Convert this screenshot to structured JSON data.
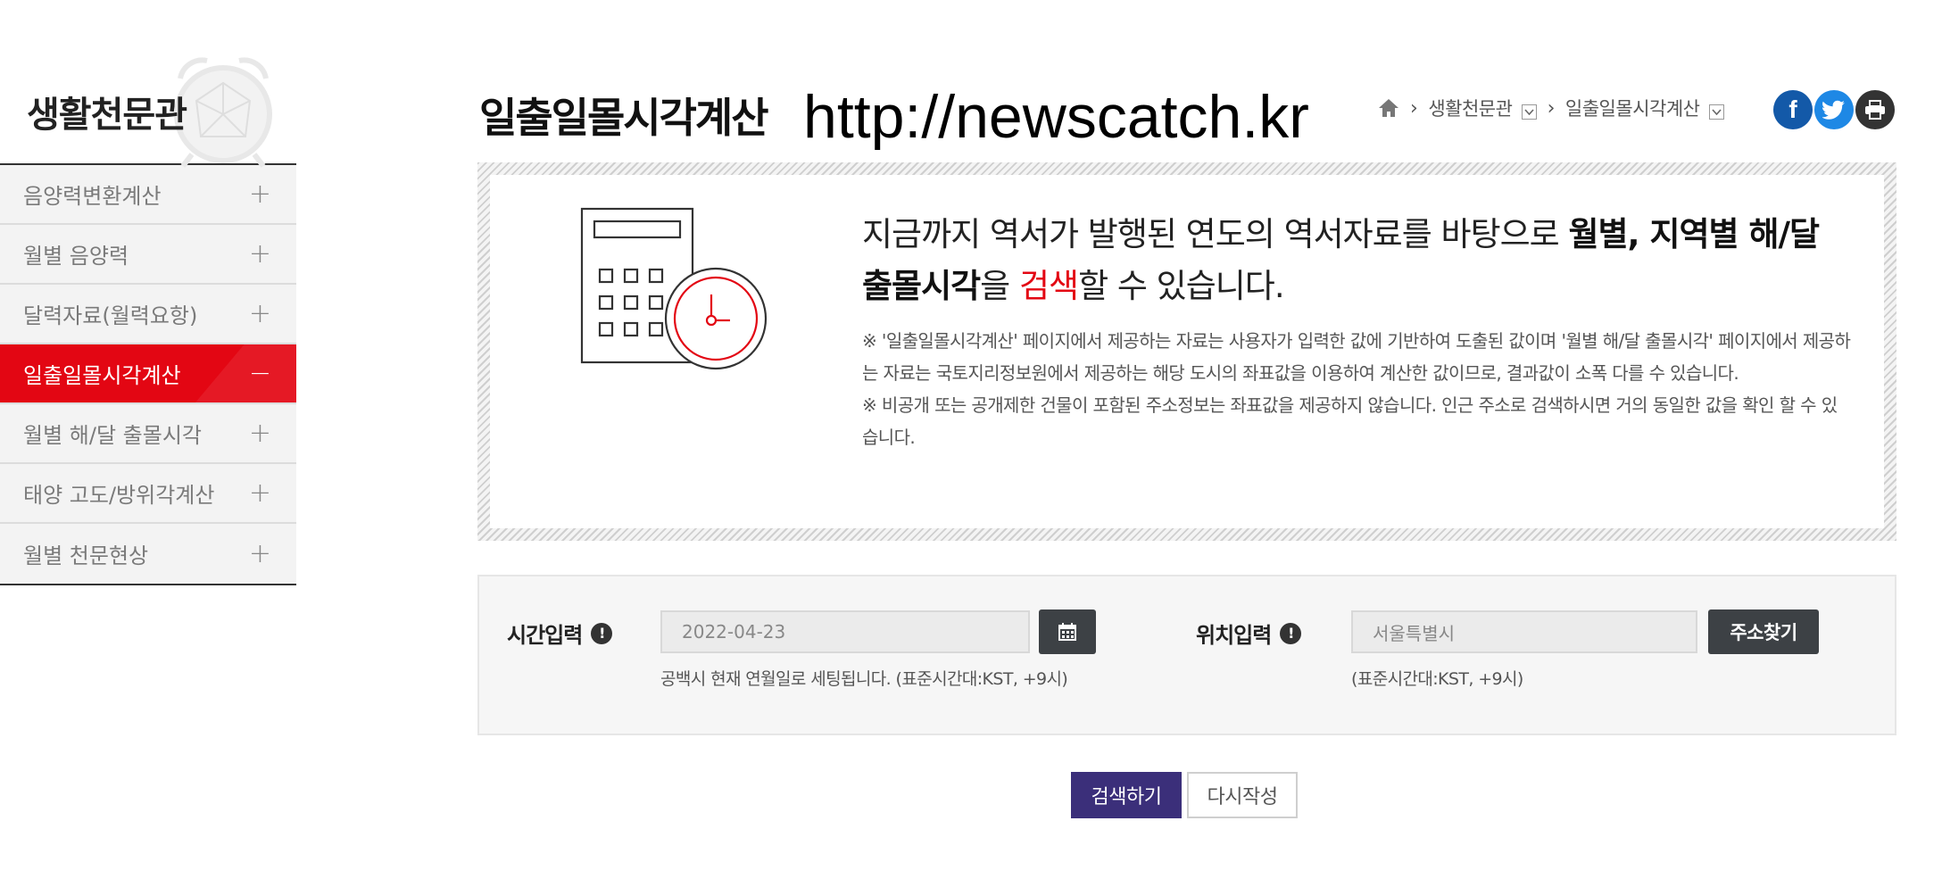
{
  "sidebar": {
    "title": "생활천문관",
    "items": [
      {
        "label": "음양력변환계산",
        "toggle": "+"
      },
      {
        "label": "월별 음양력",
        "toggle": "+"
      },
      {
        "label": "달력자료(월력요항)",
        "toggle": "+"
      },
      {
        "label": "일출일몰시각계산",
        "toggle": "−",
        "active": true
      },
      {
        "label": "월별 해/달 출몰시각",
        "toggle": "+"
      },
      {
        "label": "태양 고도/방위각계산",
        "toggle": "+"
      },
      {
        "label": "월별 천문현상",
        "toggle": "+"
      }
    ]
  },
  "header": {
    "title": "일출일몰시각계산",
    "watermark": "http://newscatch.kr",
    "breadcrumb": [
      "생활천문관",
      "일출일몰시각계산"
    ],
    "share_icons": [
      "facebook-icon",
      "twitter-icon",
      "print-icon"
    ]
  },
  "info": {
    "lead_part1": "지금까지 역서가 발행된 연도의 역서자료를 바탕으로 ",
    "lead_bold": "월별, 지역별 해/달 출몰시각",
    "lead_part2": "을 ",
    "lead_red": "검색",
    "lead_part3": "할 수 있습니다.",
    "note1": "※ '일출일몰시각계산' 페이지에서 제공하는 자료는 사용자가 입력한 값에 기반하여 도출된 값이며 '월별 해/달 출몰시각' 페이지에서 제공하는 자료는 국토지리정보원에서 제공하는 해당 도시의 좌표값을 이용하여 계산한 값이므로, 결과값이 소폭 다를 수 있습니다.",
    "note2": "※ 비공개 또는 공개제한 건물이 포함된 주소정보는 좌표값을 제공하지 않습니다. 인근 주소로 검색하시면 거의 동일한 값을 확인 할 수 있습니다."
  },
  "form": {
    "time_label": "시간입력",
    "time_value": "2022-04-23",
    "time_hint": "공백시 현재 연월일로 세팅됩니다. (표준시간대:KST, +9시)",
    "location_label": "위치입력",
    "location_placeholder": "서울특별시",
    "location_hint": "(표준시간대:KST, +9시)",
    "address_button": "주소찾기"
  },
  "actions": {
    "search": "검색하기",
    "reset": "다시작성"
  },
  "colors": {
    "accent_red": "#e30613",
    "search_button": "#3b2f7a",
    "dark_button": "#3d4145"
  }
}
